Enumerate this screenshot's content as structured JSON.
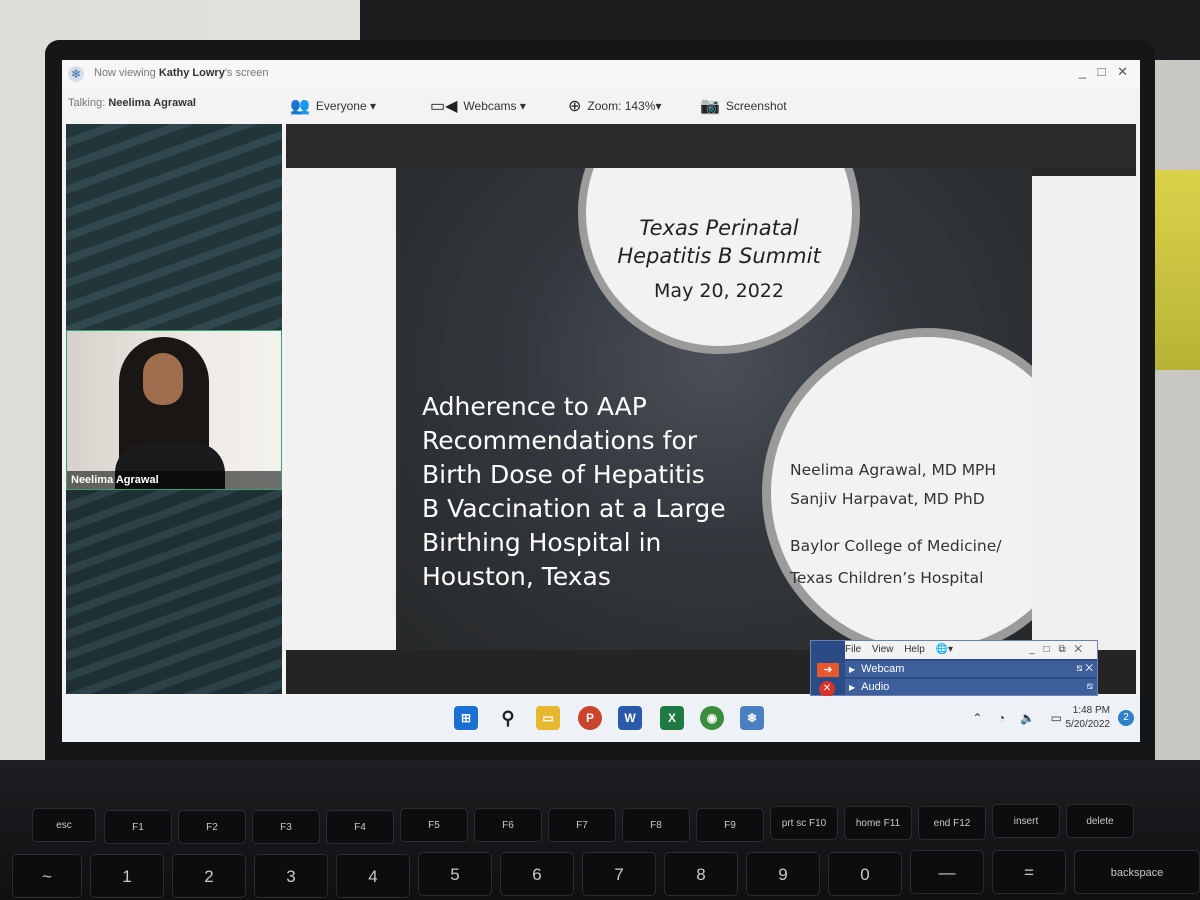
{
  "window": {
    "viewing_prefix": "Now viewing",
    "viewing_name": "Kathy Lowry",
    "viewing_suffix": "'s screen",
    "controls": "_ □ ✕"
  },
  "toolbar": {
    "talking_label": "Talking:",
    "talking_name": "Neelima Agrawal",
    "everyone": "Everyone ▾",
    "webcams": "Webcams ▾",
    "zoom": "Zoom: 143%▾",
    "screenshot": "Screenshot"
  },
  "webcam": {
    "participant": "Neelima Agrawal"
  },
  "slide": {
    "summit_line1": "Texas Perinatal",
    "summit_line2": "Hepatitis B Summit",
    "date": "May 20, 2022",
    "title_lines": [
      "Adherence to AAP",
      "Recommendations for",
      "Birth Dose of Hepatitis",
      "B Vaccination at a Large",
      "Birthing Hospital in",
      "Houston, Texas"
    ],
    "authors": [
      "Neelima Agrawal, MD MPH",
      "Sanjiv Harpavat, MD PhD"
    ],
    "affiliation": [
      "Baylor College of Medicine/",
      "Texas Children’s Hospital"
    ]
  },
  "panel": {
    "menu": [
      "File",
      "View",
      "Help"
    ],
    "rows": [
      "Webcam",
      "Audio"
    ]
  },
  "taskbar": {
    "time": "1:48 PM",
    "date": "5/20/2022",
    "notifications": "2",
    "apps": [
      {
        "name": "windows-start",
        "color": "#1b6fd1"
      },
      {
        "name": "search",
        "color": "#2a2a2a"
      },
      {
        "name": "file-explorer",
        "color": "#e8b730"
      },
      {
        "name": "powerpoint",
        "color": "#c9442a"
      },
      {
        "name": "word",
        "color": "#2a5bab"
      },
      {
        "name": "excel",
        "color": "#1e7a45"
      },
      {
        "name": "chrome",
        "color": "#3a8d3f"
      },
      {
        "name": "meeting-app",
        "color": "#4a7fc2"
      }
    ]
  },
  "keyboard": {
    "fn_row": [
      "esc",
      "F1",
      "F2",
      "F3",
      "F4",
      "F5",
      "F6",
      "F7",
      "F8",
      "F9",
      "prt sc F10",
      "home F11",
      "end F12",
      "insert",
      "delete"
    ],
    "num_row": [
      "~",
      "1",
      "2",
      "3",
      "4",
      "5",
      "6",
      "7",
      "8",
      "9",
      "0",
      "—",
      "=",
      "backspace"
    ]
  }
}
